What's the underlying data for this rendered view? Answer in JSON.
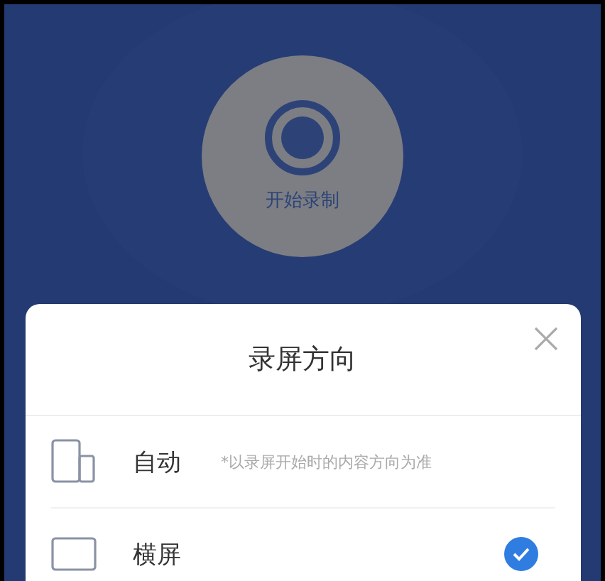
{
  "record_button": {
    "label": "开始录制"
  },
  "sheet": {
    "title": "录屏方向",
    "options": [
      {
        "kind": "auto",
        "label": "自动",
        "note": "*以录屏开始时的内容方向为准",
        "selected": false
      },
      {
        "kind": "landscape",
        "label": "横屏",
        "selected": true
      }
    ]
  }
}
